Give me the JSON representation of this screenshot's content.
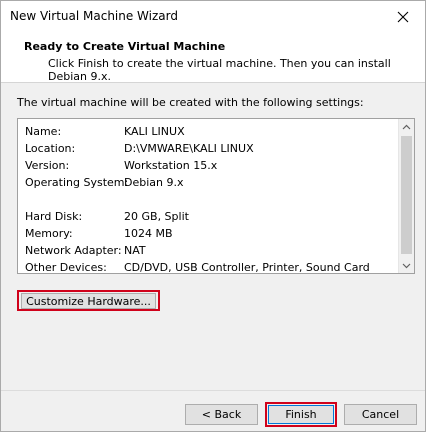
{
  "window": {
    "title": "New Virtual Machine Wizard"
  },
  "header": {
    "title": "Ready to Create Virtual Machine",
    "subtitle": "Click Finish to create the virtual machine. Then you can install Debian 9.x."
  },
  "intro_text": "The virtual machine will be created with the following settings:",
  "settings": [
    {
      "key": "Name:",
      "value": "KALI LINUX"
    },
    {
      "key": "Location:",
      "value": "D:\\VMWARE\\KALI LINUX"
    },
    {
      "key": "Version:",
      "value": "Workstation 15.x"
    },
    {
      "key": "Operating System:",
      "value": "Debian 9.x"
    },
    {
      "key": "Hard Disk:",
      "value": "20 GB, Split"
    },
    {
      "key": "Memory:",
      "value": "1024 MB"
    },
    {
      "key": "Network Adapter:",
      "value": "NAT"
    },
    {
      "key": "Other Devices:",
      "value": "CD/DVD, USB Controller, Printer, Sound Card"
    }
  ],
  "buttons": {
    "customize": "Customize Hardware...",
    "back": "< Back",
    "finish": "Finish",
    "cancel": "Cancel"
  },
  "highlight_color": "#d0021b",
  "icons": {
    "close": "close-icon",
    "scroll_up": "chevron-up-icon",
    "scroll_down": "chevron-down-icon"
  }
}
